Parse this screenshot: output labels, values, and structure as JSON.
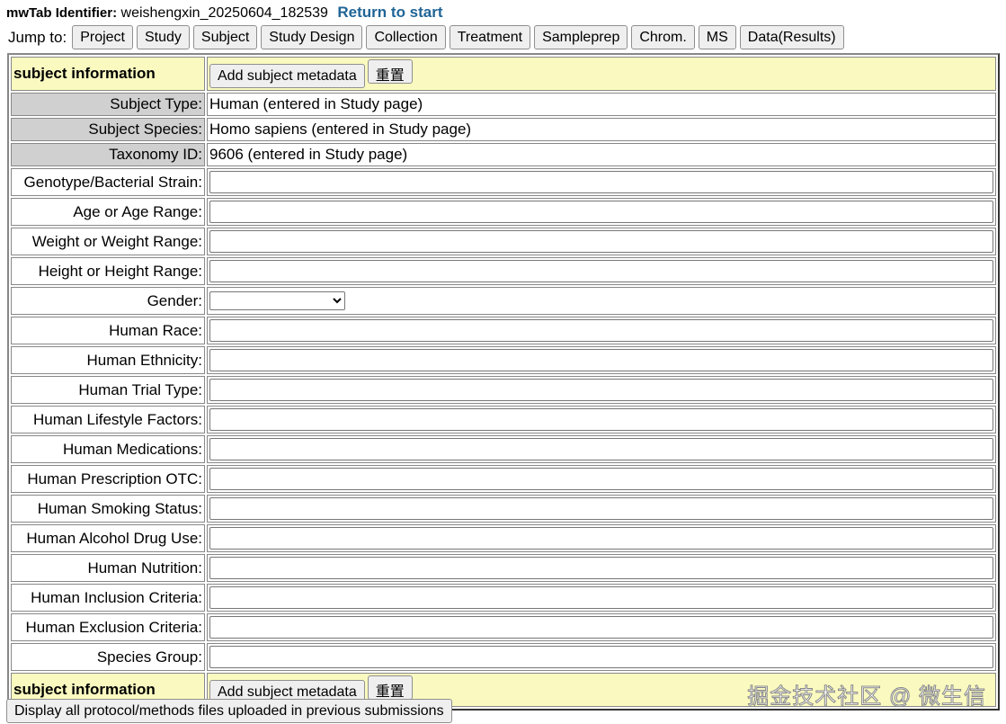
{
  "header": {
    "identifier_label": "mwTab Identifier:",
    "identifier_value": "weishengxin_20250604_182539",
    "return_link": "Return to start"
  },
  "jump": {
    "label": "Jump to:",
    "buttons": [
      "Project",
      "Study",
      "Subject",
      "Study Design",
      "Collection",
      "Treatment",
      "Sampleprep",
      "Chrom.",
      "MS",
      "Data(Results)"
    ]
  },
  "section": {
    "title": "subject information",
    "add_button": "Add subject metadata",
    "reset_button": "重置"
  },
  "readonly": [
    {
      "label": "Subject Type:",
      "value": "Human (entered in Study page)"
    },
    {
      "label": "Subject Species:",
      "value": "Homo sapiens (entered in Study page)"
    },
    {
      "label": "Taxonomy ID:",
      "value": "9606 (entered in Study page)"
    }
  ],
  "fields": {
    "genotype": "Genotype/Bacterial Strain:",
    "age": "Age or Age Range:",
    "weight": "Weight or Weight Range:",
    "height": "Height or Height Range:",
    "gender": "Gender:",
    "race": "Human Race:",
    "ethnicity": "Human Ethnicity:",
    "trial": "Human Trial Type:",
    "lifestyle": "Human Lifestyle Factors:",
    "medications": "Human Medications:",
    "otc": "Human Prescription OTC:",
    "smoking": "Human Smoking Status:",
    "alcohol": "Human Alcohol Drug Use:",
    "nutrition": "Human Nutrition:",
    "inclusion": "Human Inclusion Criteria:",
    "exclusion": "Human Exclusion Criteria:",
    "species_group": "Species Group:"
  },
  "gender_selected": "",
  "bottom_button": "Display all protocol/methods files uploaded in previous submissions",
  "watermark": "掘金技术社区 @ 微生信"
}
